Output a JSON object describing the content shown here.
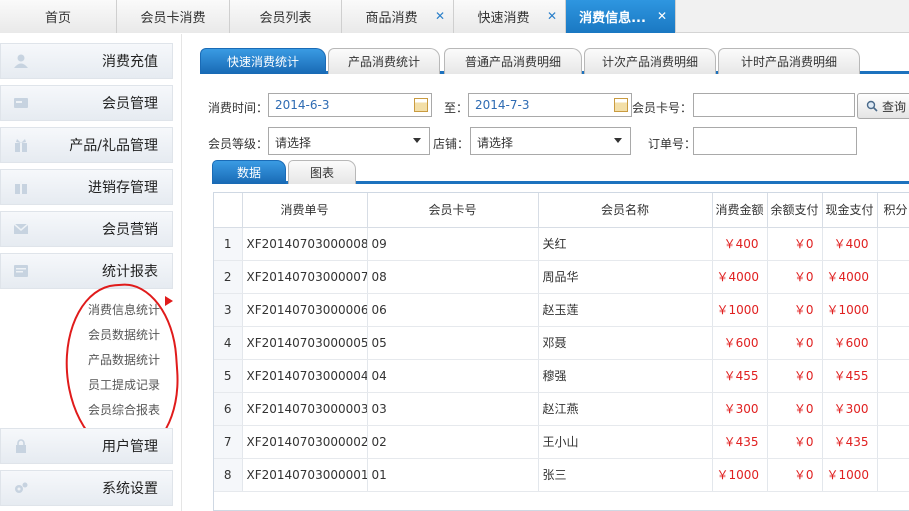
{
  "top_tabs": [
    {
      "label": "首页",
      "closable": false,
      "active": false
    },
    {
      "label": "会员卡消费",
      "closable": false,
      "active": false
    },
    {
      "label": "会员列表",
      "closable": false,
      "active": false
    },
    {
      "label": "商品消费",
      "closable": true,
      "active": false
    },
    {
      "label": "快速消费",
      "closable": true,
      "active": false
    },
    {
      "label": "消费信息...",
      "closable": true,
      "active": true
    }
  ],
  "sidebar": {
    "items": [
      {
        "label": "消费充值",
        "icon": "user-icon"
      },
      {
        "label": "会员管理",
        "icon": "card-icon"
      },
      {
        "label": "产品/礼品管理",
        "icon": "gift-icon"
      },
      {
        "label": "进销存管理",
        "icon": "gift-box-icon"
      },
      {
        "label": "会员营销",
        "icon": "mail-icon"
      },
      {
        "label": "统计报表",
        "icon": "report-icon"
      },
      {
        "label": "用户管理",
        "icon": "lock-icon"
      },
      {
        "label": "系统设置",
        "icon": "gear-icon"
      }
    ],
    "sub_items": [
      "消费信息统计",
      "会员数据统计",
      "产品数据统计",
      "员工提成记录",
      "会员综合报表"
    ]
  },
  "sub_tabs": [
    "快速消费统计",
    "产品消费统计",
    "普通产品消费明细",
    "计次产品消费明细",
    "计时产品消费明细"
  ],
  "filters": {
    "time_label": "消费时间：",
    "start_date": "2014-6-3",
    "to_label": "至：",
    "end_date": "2014-7-3",
    "card_label": "会员卡号：",
    "card_value": "",
    "search_label": "查询",
    "level_label": "会员等级：",
    "level_value": "请选择",
    "shop_label": "店铺：",
    "shop_value": "请选择",
    "order_label": "订单号：",
    "order_value": ""
  },
  "data_tabs": [
    "数据",
    "图表"
  ],
  "table": {
    "headers": [
      "消费单号",
      "会员卡号",
      "会员名称",
      "消费金额",
      "余额支付",
      "现金支付",
      "积分"
    ],
    "rows": [
      {
        "idx": "1",
        "order": "XF20140703000008",
        "card": "09",
        "name": "关红",
        "amount": "￥400",
        "balance": "￥0",
        "cash": "￥400"
      },
      {
        "idx": "2",
        "order": "XF20140703000007",
        "card": "08",
        "name": "周品华",
        "amount": "￥4000",
        "balance": "￥0",
        "cash": "￥4000"
      },
      {
        "idx": "3",
        "order": "XF20140703000006",
        "card": "06",
        "name": "赵玉莲",
        "amount": "￥1000",
        "balance": "￥0",
        "cash": "￥1000"
      },
      {
        "idx": "4",
        "order": "XF20140703000005",
        "card": "05",
        "name": "邓聂",
        "amount": "￥600",
        "balance": "￥0",
        "cash": "￥600"
      },
      {
        "idx": "5",
        "order": "XF20140703000004",
        "card": "04",
        "name": "穆强",
        "amount": "￥455",
        "balance": "￥0",
        "cash": "￥455"
      },
      {
        "idx": "6",
        "order": "XF20140703000003",
        "card": "03",
        "name": "赵江燕",
        "amount": "￥300",
        "balance": "￥0",
        "cash": "￥300"
      },
      {
        "idx": "7",
        "order": "XF20140703000002",
        "card": "02",
        "name": "王小山",
        "amount": "￥435",
        "balance": "￥0",
        "cash": "￥435"
      },
      {
        "idx": "8",
        "order": "XF20140703000001",
        "card": "01",
        "name": "张三",
        "amount": "￥1000",
        "balance": "￥0",
        "cash": "￥1000"
      }
    ]
  },
  "colors": {
    "accent": "#1d72be",
    "money": "#e02020",
    "annotation": "#e01b1b"
  }
}
